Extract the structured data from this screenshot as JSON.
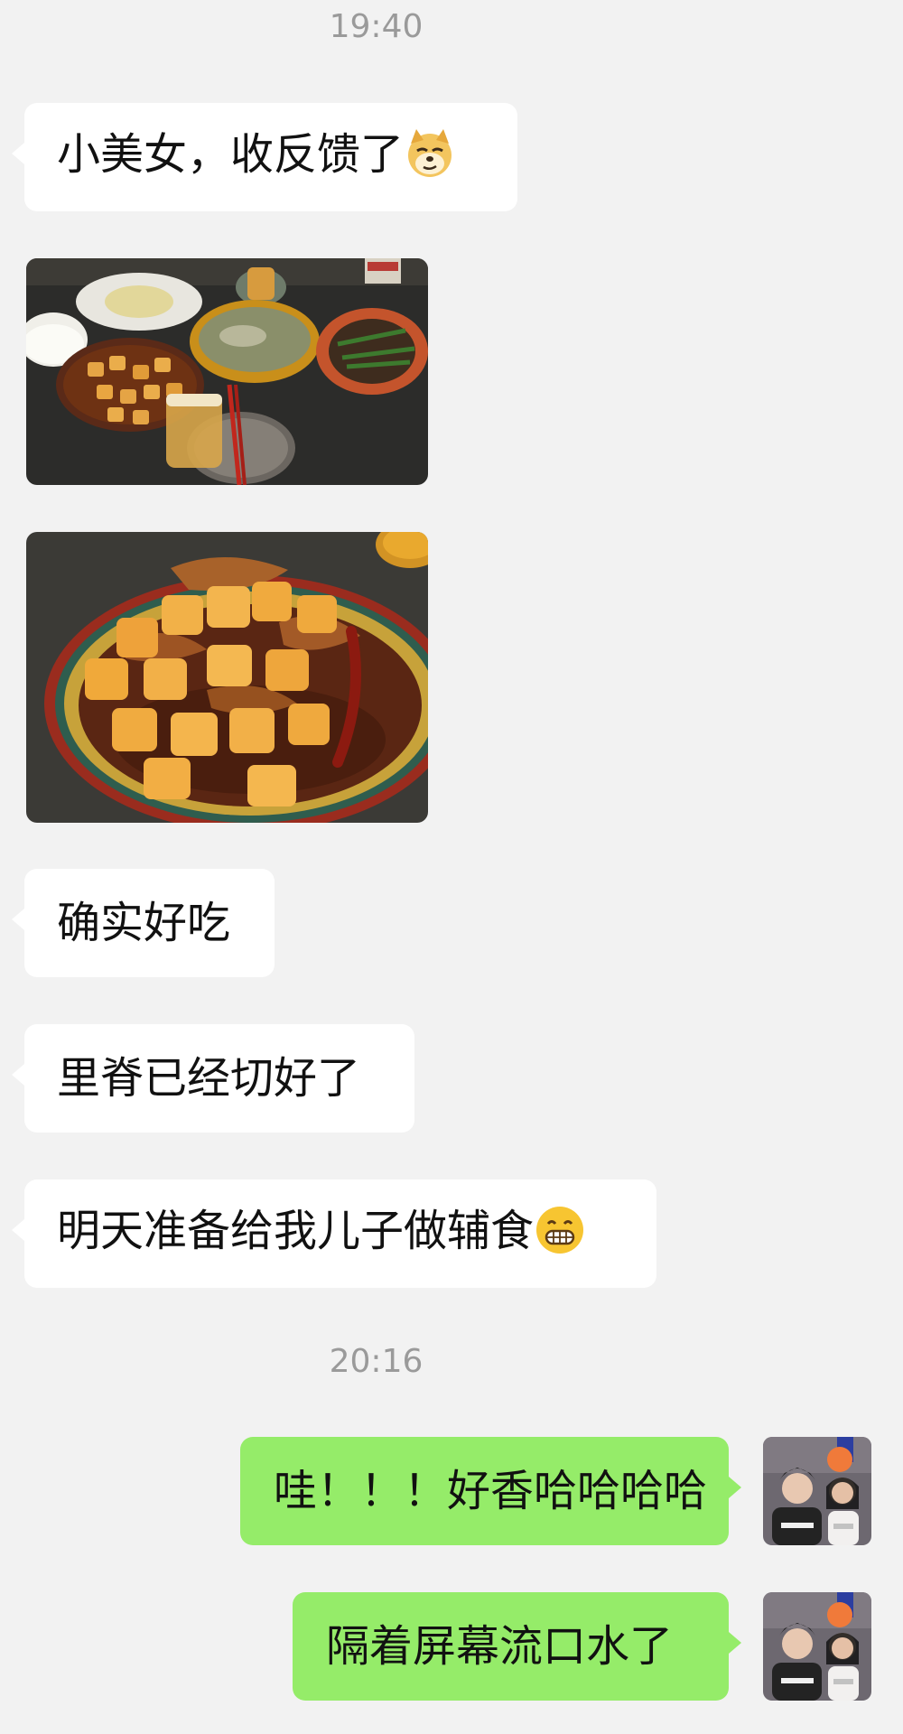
{
  "timestamps": {
    "first": "19:40",
    "second": "20:16"
  },
  "messages": {
    "msg1": "小美女，收反馈了",
    "msg2": "确实好吃",
    "msg3": "里脊已经切好了",
    "msg4": "明天准备给我儿子做辅食",
    "msg5": "哇！！！好香哈哈哈哈",
    "msg6": "隔着屏幕流口水了"
  },
  "emojis": {
    "msg1": "doge-emoji",
    "msg4": "grinning-face-emoji"
  },
  "colors": {
    "background": "#f2f2f2",
    "incoming_bubble": "#ffffff",
    "outgoing_bubble": "#95ec69",
    "timestamp_text": "#9a9a9a"
  }
}
